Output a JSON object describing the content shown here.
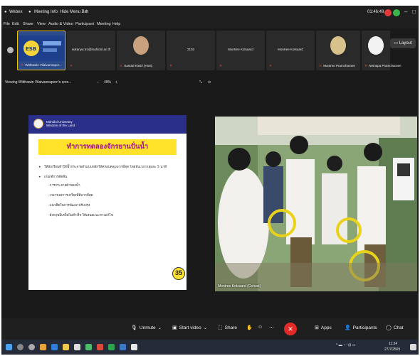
{
  "window": {
    "app_name": "Webex",
    "meeting_info": "Meeting Info",
    "hide_menu_bar": "Hide Menu Bar",
    "timer": "01:46:49"
  },
  "menu": [
    "File",
    "Edit",
    "Share",
    "View",
    "Audio & Video",
    "Participant",
    "Meeting",
    "Help"
  ],
  "participants": [
    {
      "name": "Witthawin Vilaivannapor..."
    },
    {
      "name": "sukanya.tro@mahidol.ac.th"
    },
    {
      "name": "Santad Kitsiri (Host)"
    },
    {
      "name": "2102"
    },
    {
      "name": "Montree Kotsaard"
    },
    {
      "name": "Montree Kotsaard"
    },
    {
      "name": "Montree Pramcharoen"
    },
    {
      "name": "Netnapa Pramcharoen"
    }
  ],
  "layout_label": "Layout",
  "viewing": {
    "label": "Viewing Witthawin Vilaivannaporn's scre...",
    "zoom": "49%"
  },
  "slide": {
    "university": "Mahidol University",
    "university_sub": "Wisdom of the Land",
    "title": "ทำการทดลองจักรยานปั่นน้ำ",
    "bullets": [
      "ให้นักเรียนทำให้น้ำกระจายตัวแบบหยักให้ครอบคลุมมากที่สุด โดยจับเวลากลุ่มละ 5 นาที",
      "เกณฑ์การตัดสิน"
    ],
    "sub_items": [
      "-การกระจายตัวของน้ำ",
      "-เวลาของการเหวี่ยงที่ดีมากที่สุด",
      "-แนวคิดในการพัฒนาปรับปรุง",
      "-อังกฤษมีเคล็ดไม่สำเร็จ ให้เสนอแนะทางแก้ไข"
    ],
    "page": "35"
  },
  "video": {
    "label": "Montree Kotsaard (Cohost)"
  },
  "controls": {
    "unmute": "Unmute",
    "start_video": "Start video",
    "share": "Share",
    "apps": "Apps",
    "participants": "Participants",
    "chat": "Chat"
  },
  "taskbar": {
    "time": "11:24",
    "date": "27/7/2565"
  },
  "colors": {
    "slide_header": "#2a2f8a",
    "slide_title_bg": "#ffe229",
    "slide_title_text": "#a0108a",
    "leave_button": "#e02b26",
    "active_speaker": "#f5c400"
  }
}
